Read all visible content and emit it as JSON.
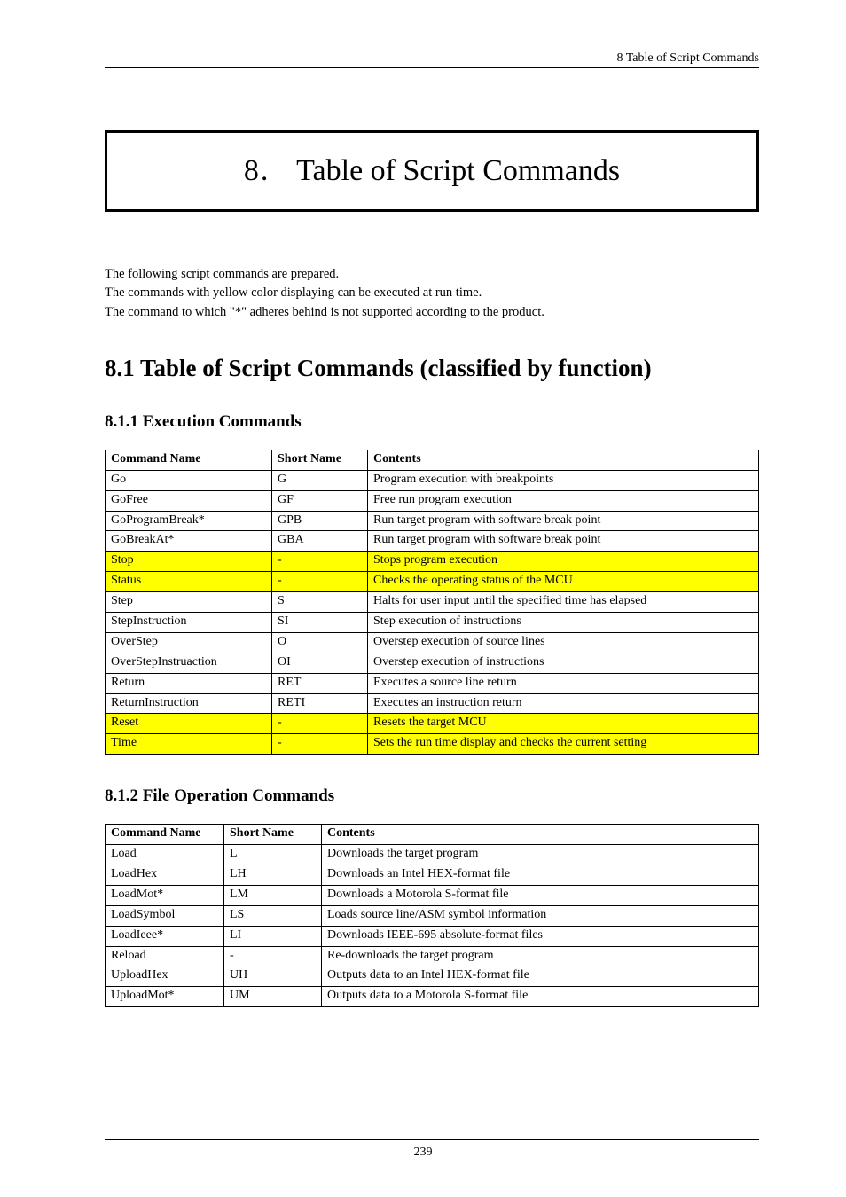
{
  "running_header": "8  Table  of  Script  Commands",
  "chapter": {
    "number": "8.",
    "title": "Table of Script Commands"
  },
  "intro": {
    "p1": "The following script commands are prepared.",
    "p2": "The commands with yellow color displaying can be executed at run time.",
    "p3": "The command to which \"*\" adheres behind is not supported according to the product."
  },
  "section_8_1": "8.1 Table of Script Commands (classified by function)",
  "sub_8_1_1": "8.1.1 Execution Commands",
  "sub_8_1_2": "8.1.2 File Operation Commands",
  "table_exec": {
    "headers": {
      "name": "Command Name",
      "short": "Short Name",
      "contents": "Contents"
    },
    "rows": [
      {
        "name": "Go",
        "short": "G",
        "contents": "Program execution with breakpoints",
        "hl": false
      },
      {
        "name": "GoFree",
        "short": "GF",
        "contents": "Free run program execution",
        "hl": false
      },
      {
        "name": "GoProgramBreak*",
        "short": "GPB",
        "contents": "Run target program with software break point",
        "hl": false
      },
      {
        "name": "GoBreakAt*",
        "short": "GBA",
        "contents": "Run target program with software break point",
        "hl": false
      },
      {
        "name": "Stop",
        "short": "-",
        "contents": "Stops program execution",
        "hl": true
      },
      {
        "name": "Status",
        "short": "-",
        "contents": "Checks the operating status of the MCU",
        "hl": true
      },
      {
        "name": "Step",
        "short": "S",
        "contents": "Halts for user input until the specified time has elapsed",
        "hl": false
      },
      {
        "name": "StepInstruction",
        "short": "SI",
        "contents": "Step execution of instructions",
        "hl": false
      },
      {
        "name": "OverStep",
        "short": "O",
        "contents": "Overstep execution of source lines",
        "hl": false
      },
      {
        "name": "OverStepInstruaction",
        "short": "OI",
        "contents": "Overstep execution of instructions",
        "hl": false
      },
      {
        "name": "Return",
        "short": "RET",
        "contents": "Executes a source line return",
        "hl": false
      },
      {
        "name": "ReturnInstruction",
        "short": "RETI",
        "contents": "Executes an instruction return",
        "hl": false
      },
      {
        "name": "Reset",
        "short": "-",
        "contents": "Resets the target MCU",
        "hl": true
      },
      {
        "name": "Time",
        "short": "-",
        "contents": "Sets the run time display and checks the current setting",
        "hl": true
      }
    ]
  },
  "table_file": {
    "headers": {
      "name": "Command Name",
      "short": "Short Name",
      "contents": "Contents"
    },
    "rows": [
      {
        "name": "Load",
        "short": "L",
        "contents": "Downloads the target program"
      },
      {
        "name": "LoadHex",
        "short": "LH",
        "contents": "Downloads an Intel HEX-format file"
      },
      {
        "name": "LoadMot*",
        "short": "LM",
        "contents": "Downloads a Motorola S-format file"
      },
      {
        "name": "LoadSymbol",
        "short": "LS",
        "contents": "Loads source line/ASM symbol information"
      },
      {
        "name": "LoadIeee*",
        "short": "LI",
        "contents": "Downloads IEEE-695 absolute-format files"
      },
      {
        "name": "Reload",
        "short": "-",
        "contents": "Re-downloads the target program"
      },
      {
        "name": "UploadHex",
        "short": "UH",
        "contents": "Outputs data to an Intel HEX-format file"
      },
      {
        "name": "UploadMot*",
        "short": "UM",
        "contents": "Outputs data to a Motorola S-format file"
      }
    ]
  },
  "page_number": "239"
}
